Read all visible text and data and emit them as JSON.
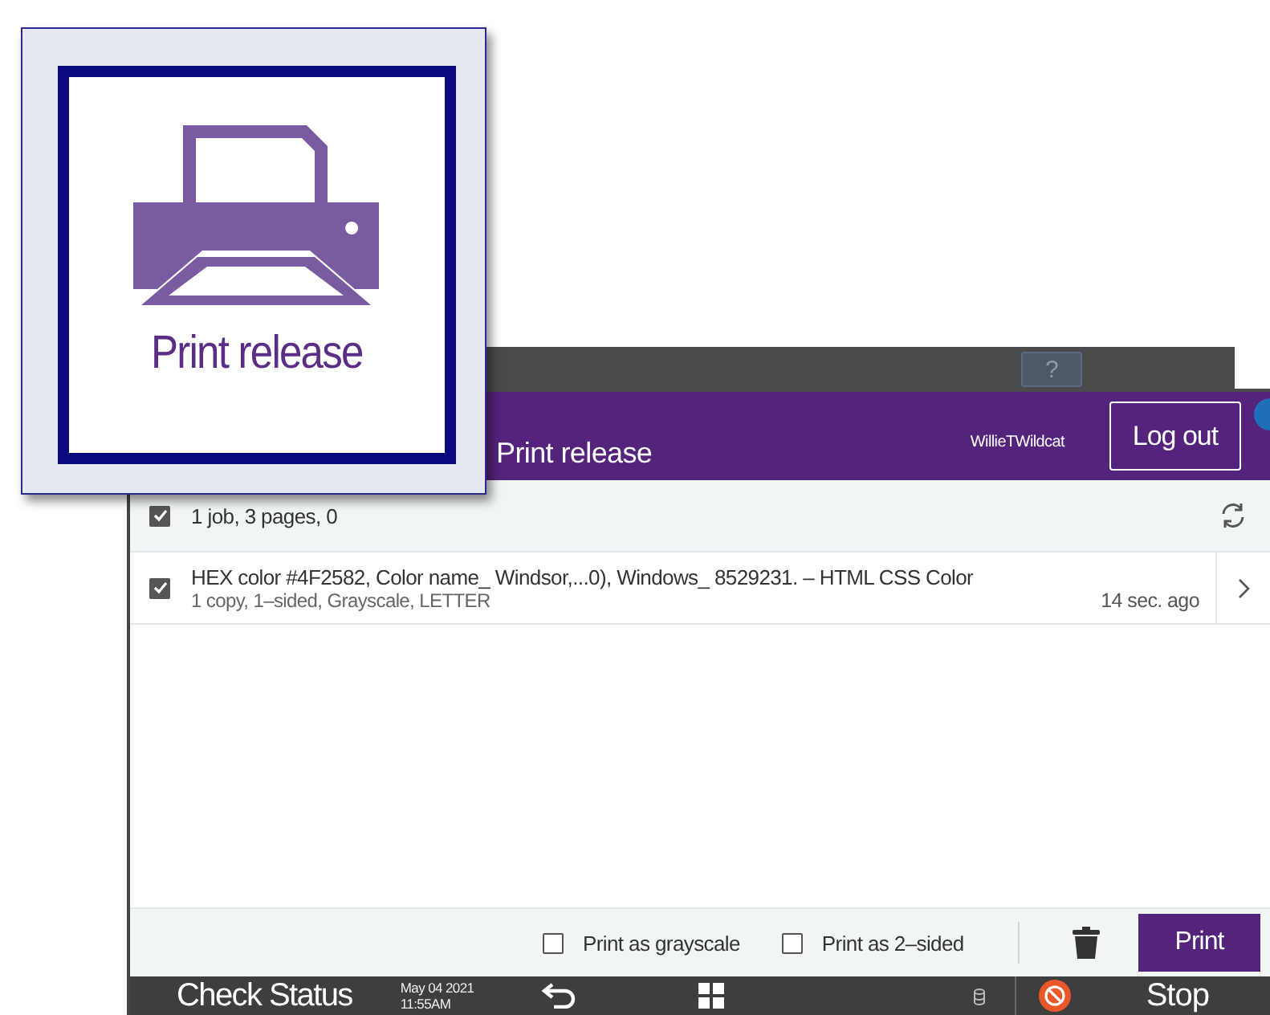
{
  "callout": {
    "label": "Print release"
  },
  "top_bar": {
    "help": "?"
  },
  "header": {
    "title": "Print release",
    "user": "WillieTWildcat",
    "logout": "Log out"
  },
  "summary": {
    "text": "1 job, 3 pages, 0",
    "checked": true
  },
  "jobs": [
    {
      "title": "HEX color #4F2582, Color name_ Windsor,...0), Windows_ 8529231. – HTML CSS Color",
      "details": "1 copy, 1–sided, Grayscale, LETTER",
      "age": "14 sec. ago",
      "checked": true
    }
  ],
  "options": [
    {
      "label": "Print as grayscale",
      "checked": false
    },
    {
      "label": "Print as 2–sided",
      "checked": false
    }
  ],
  "print_button": "Print",
  "status_bar": {
    "check_status": "Check Status",
    "date": "May 04 2021",
    "time": "11:55AM",
    "stop": "Stop"
  }
}
